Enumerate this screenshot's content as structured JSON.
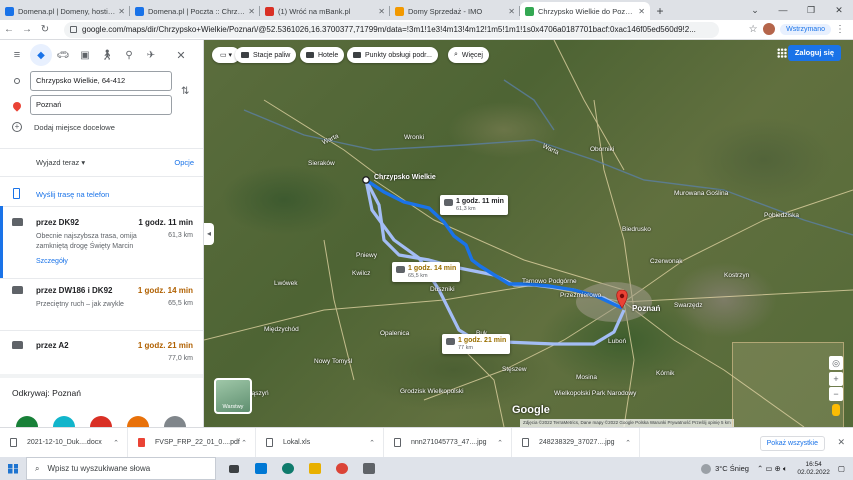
{
  "browser": {
    "tabs": [
      {
        "title": "Domena.pl | Domeny, hosting, n",
        "color": "#1a73e8"
      },
      {
        "title": "Domena.pl | Poczta :: Chrzypsko",
        "color": "#1a73e8"
      },
      {
        "title": "(1) Wróć na mBank.pl",
        "color": "#d93025"
      },
      {
        "title": "Domy Sprzedaż - IMO",
        "color": "#f29900"
      },
      {
        "title": "Chrzypsko Wielkie do Poznań - G",
        "color": "#34a853"
      }
    ],
    "url": "google.com/maps/dir/Chrzypsko+Wielkie/Poznań/@52.5361026,16.3700377,71799m/data=!3m1!1e3!4m13!4m12!1m5!1m1!1s0x4706a0187701bacf:0xac146f05ed560d9!2...",
    "profile_button": "Wstrzymano"
  },
  "panel": {
    "origin": "Chrzypsko Wielkie, 64-412",
    "destination": "Poznań",
    "add_destination": "Dodaj miejsce docelowe",
    "depart": "Wyjazd teraz",
    "options": "Opcje",
    "send_to_phone": "Wyślij trasę na telefon",
    "routes": [
      {
        "name": "przez DK92",
        "time": "1 godz. 11 min",
        "dist": "61,3 km",
        "desc": "Obecnie najszybsza trasa, omija zamkniętą drogę Święty Marcin",
        "time_color": "#202124"
      },
      {
        "name": "przez DW186 i DK92",
        "time": "1 godz. 14 min",
        "dist": "65,5 km",
        "desc": "Przeciętny ruch – jak zwykle",
        "time_color": "#b06000"
      },
      {
        "name": "przez A2",
        "time": "1 godz. 21 min",
        "dist": "77,0 km",
        "desc": "",
        "time_color": "#b06000"
      }
    ],
    "details": "Szczegóły",
    "explore": "Odkrywaj: Poznań",
    "explore_colors": [
      "#188038",
      "#12b5cb",
      "#d93025",
      "#e8710a",
      "#80868b"
    ]
  },
  "map": {
    "chips": [
      {
        "label": "Stacje paliw"
      },
      {
        "label": "Hotele"
      },
      {
        "label": "Punkty obsługi podr..."
      },
      {
        "label": "Więcej"
      }
    ],
    "login": "Zaloguj się",
    "origin_label": "Chrzypsko Wielkie",
    "dest_label": "Poznań",
    "route_boxes": [
      {
        "time": "1 godz. 11 min",
        "dist": "61,3 km"
      },
      {
        "time": "1 godz. 14 min",
        "dist": "65,5 km"
      },
      {
        "time": "1 godz. 21 min",
        "dist": "77 km"
      }
    ],
    "place_labels": [
      "Warta",
      "Warta",
      "Sieraków",
      "Kwilcz",
      "Pniewy",
      "Duszniki",
      "Tarnowo Podgórne",
      "Przeźmierowo",
      "Swarzędz",
      "Oborniki",
      "Biedrusko",
      "Buk",
      "Opalenica",
      "Grodzisk Wielkopolski",
      "Stęszew",
      "Mosina",
      "Kórnik",
      "Wielkopolski Park Narodowy",
      "Kostrzyn",
      "Międzychód",
      "Wronki",
      "Murowana Goślina",
      "Zbąszyń",
      "Nowy Tomyśl",
      "Pobiedziska",
      "Czerwonak",
      "Lwówek",
      "Luboń"
    ],
    "google": "Google",
    "attribution": "Zdjęcia ©2022 TerraMetrics, Dane mapy ©2022 Google   Polska   Warunki   Prywatność   Prześlij opinię   5 km",
    "layers": "Warstwy"
  },
  "downloads": {
    "items": [
      {
        "name": "2021-12-10_Duk....docx",
        "type": "doc"
      },
      {
        "name": "FVSP_FRP_22_01_0....pdf",
        "type": "pdf"
      },
      {
        "name": "Lokal.xls",
        "type": "doc"
      },
      {
        "name": "nnn271045773_47....jpg",
        "type": "doc"
      },
      {
        "name": "248238329_37027....jpg",
        "type": "doc"
      }
    ],
    "show_all": "Pokaż wszystkie"
  },
  "taskbar": {
    "search": "Wpisz tu wyszukiwane słowa",
    "weather": "3°C Śnieg",
    "time": "16:54",
    "date": "02.02.2022",
    "app_colors": [
      "#3c4043",
      "#0078d4",
      "#0f7b6c",
      "#e8b000",
      "#db4437",
      "#5f6368"
    ]
  }
}
